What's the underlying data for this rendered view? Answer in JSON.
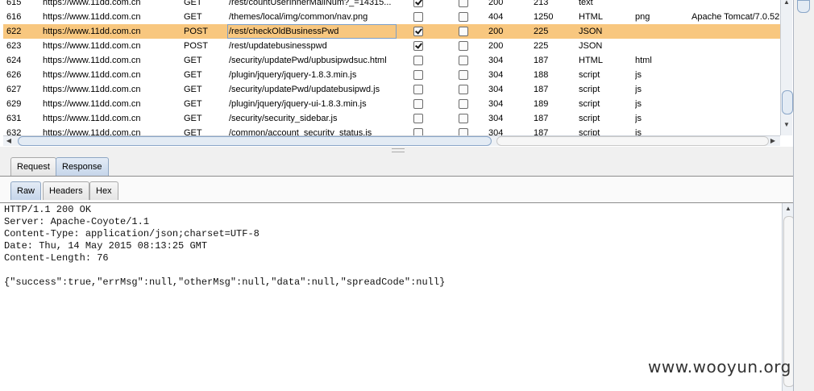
{
  "history": {
    "rows": [
      {
        "num": "615",
        "host": "https://www.11dd.com.cn",
        "method": "GET",
        "url": "/rest/countUserInnerMailNum?_=14315...",
        "params": true,
        "edited": false,
        "status": "200",
        "length": "213",
        "mime": "text",
        "ext": "",
        "server": "",
        "selected": false
      },
      {
        "num": "616",
        "host": "https://www.11dd.com.cn",
        "method": "GET",
        "url": "/themes/local/img/common/nav.png",
        "params": false,
        "edited": false,
        "status": "404",
        "length": "1250",
        "mime": "HTML",
        "ext": "png",
        "server": "Apache Tomcat/7.0.52",
        "selected": false
      },
      {
        "num": "622",
        "host": "https://www.11dd.com.cn",
        "method": "POST",
        "url": "/rest/checkOldBusinessPwd",
        "params": true,
        "edited": false,
        "status": "200",
        "length": "225",
        "mime": "JSON",
        "ext": "",
        "server": "",
        "selected": true
      },
      {
        "num": "623",
        "host": "https://www.11dd.com.cn",
        "method": "POST",
        "url": "/rest/updatebusinesspwd",
        "params": true,
        "edited": false,
        "status": "200",
        "length": "225",
        "mime": "JSON",
        "ext": "",
        "server": "",
        "selected": false
      },
      {
        "num": "624",
        "host": "https://www.11dd.com.cn",
        "method": "GET",
        "url": "/security/updatePwd/upbusipwdsuc.html",
        "params": false,
        "edited": false,
        "status": "304",
        "length": "187",
        "mime": "HTML",
        "ext": "html",
        "server": "",
        "selected": false
      },
      {
        "num": "626",
        "host": "https://www.11dd.com.cn",
        "method": "GET",
        "url": "/plugin/jquery/jquery-1.8.3.min.js",
        "params": false,
        "edited": false,
        "status": "304",
        "length": "188",
        "mime": "script",
        "ext": "js",
        "server": "",
        "selected": false
      },
      {
        "num": "627",
        "host": "https://www.11dd.com.cn",
        "method": "GET",
        "url": "/security/updatePwd/updatebusipwd.js",
        "params": false,
        "edited": false,
        "status": "304",
        "length": "187",
        "mime": "script",
        "ext": "js",
        "server": "",
        "selected": false
      },
      {
        "num": "629",
        "host": "https://www.11dd.com.cn",
        "method": "GET",
        "url": "/plugin/jquery/jquery-ui-1.8.3.min.js",
        "params": false,
        "edited": false,
        "status": "304",
        "length": "189",
        "mime": "script",
        "ext": "js",
        "server": "",
        "selected": false
      },
      {
        "num": "631",
        "host": "https://www.11dd.com.cn",
        "method": "GET",
        "url": "/security/security_sidebar.js",
        "params": false,
        "edited": false,
        "status": "304",
        "length": "187",
        "mime": "script",
        "ext": "js",
        "server": "",
        "selected": false
      },
      {
        "num": "632",
        "host": "https://www.11dd.com.cn",
        "method": "GET",
        "url": "/common/account_security_status.js",
        "params": false,
        "edited": false,
        "status": "304",
        "length": "187",
        "mime": "script",
        "ext": "js",
        "server": "",
        "selected": false
      }
    ]
  },
  "tabs_outer": [
    {
      "label": "Request",
      "active": false
    },
    {
      "label": "Response",
      "active": true
    }
  ],
  "tabs_inner": [
    {
      "label": "Raw",
      "active": true
    },
    {
      "label": "Headers",
      "active": false
    },
    {
      "label": "Hex",
      "active": false
    }
  ],
  "response": {
    "lines": [
      "HTTP/1.1 200 OK",
      "Server: Apache-Coyote/1.1",
      "Content-Type: application/json;charset=UTF-8",
      "Date: Thu, 14 May 2015 08:13:25 GMT",
      "Content-Length: 76",
      "",
      "{\"success\":true,\"errMsg\":null,\"otherMsg\":null,\"data\":null,\"spreadCode\":null}"
    ]
  },
  "watermark": "www.wooyun.org",
  "colors": {
    "selected_row": "#f8c77f",
    "tab_active": "#c5d5ea"
  }
}
